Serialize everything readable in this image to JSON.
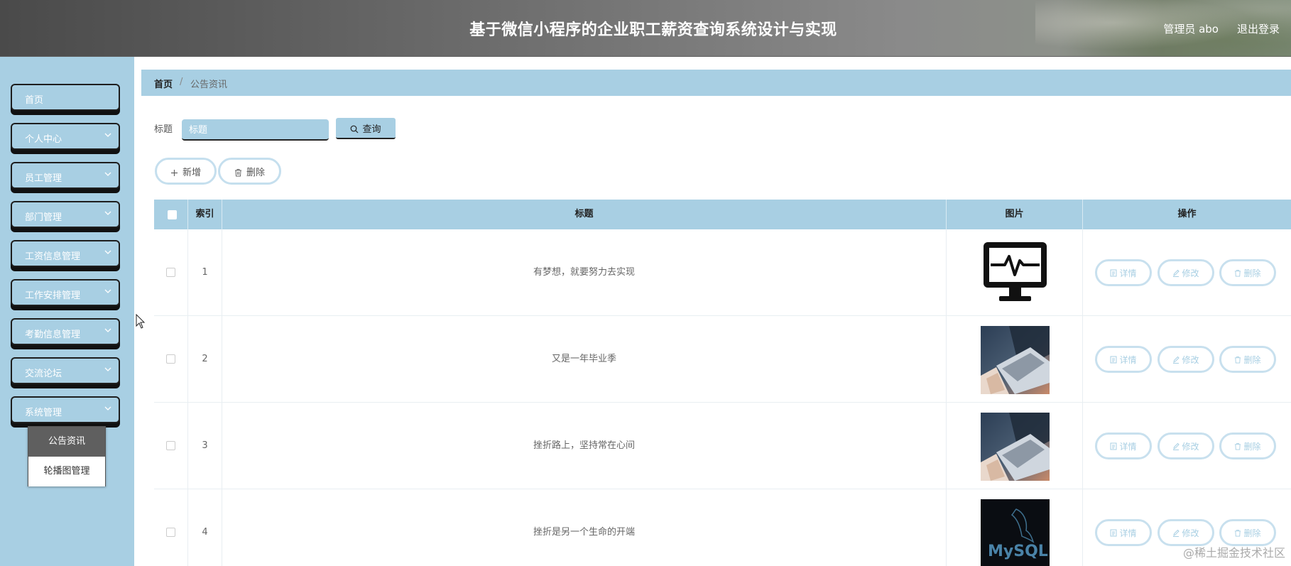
{
  "header": {
    "title": "基于微信小程序的企业职工薪资查询系统设计与实现",
    "admin_label": "管理员 abo",
    "logout_label": "退出登录"
  },
  "sidebar": {
    "items": [
      {
        "label": "首页",
        "has_chevron": false
      },
      {
        "label": "个人中心",
        "has_chevron": true
      },
      {
        "label": "员工管理",
        "has_chevron": true
      },
      {
        "label": "部门管理",
        "has_chevron": true
      },
      {
        "label": "工资信息管理",
        "has_chevron": true
      },
      {
        "label": "工作安排管理",
        "has_chevron": true
      },
      {
        "label": "考勤信息管理",
        "has_chevron": true
      },
      {
        "label": "交流论坛",
        "has_chevron": true
      },
      {
        "label": "系统管理",
        "has_chevron": true
      }
    ],
    "submenu": {
      "items": [
        {
          "label": "公告资讯",
          "active": true
        },
        {
          "label": "轮播图管理",
          "active": false
        }
      ]
    }
  },
  "breadcrumb": {
    "home": "首页",
    "current": "公告资讯"
  },
  "search": {
    "label": "标题",
    "placeholder": "标题",
    "value": "",
    "button_label": "查询"
  },
  "toolbar": {
    "add_label": "新增",
    "delete_label": "删除"
  },
  "table": {
    "columns": [
      "",
      "索引",
      "标题",
      "图片",
      "操作"
    ],
    "rows": [
      {
        "index": "1",
        "title": "有梦想，就要努力去实现",
        "image_icon": "monitor-heartbeat-icon"
      },
      {
        "index": "2",
        "title": "又是一年毕业季",
        "image_icon": "laptop-photo"
      },
      {
        "index": "3",
        "title": "挫折路上，坚持常在心间",
        "image_icon": "laptop-photo"
      },
      {
        "index": "4",
        "title": "挫折是另一个生命的开端",
        "image_icon": "mysql-logo",
        "image_text": "MySQL"
      }
    ],
    "actions": {
      "detail": "详情",
      "edit": "修改",
      "delete": "删除"
    }
  },
  "watermark": "@稀土掘金技术社区",
  "colors": {
    "accent": "#a8cfe3",
    "header_dark": "#4a4a4a",
    "sidebar_bg": "#a8cfe3",
    "submenu_active": "#5f5f5f"
  }
}
